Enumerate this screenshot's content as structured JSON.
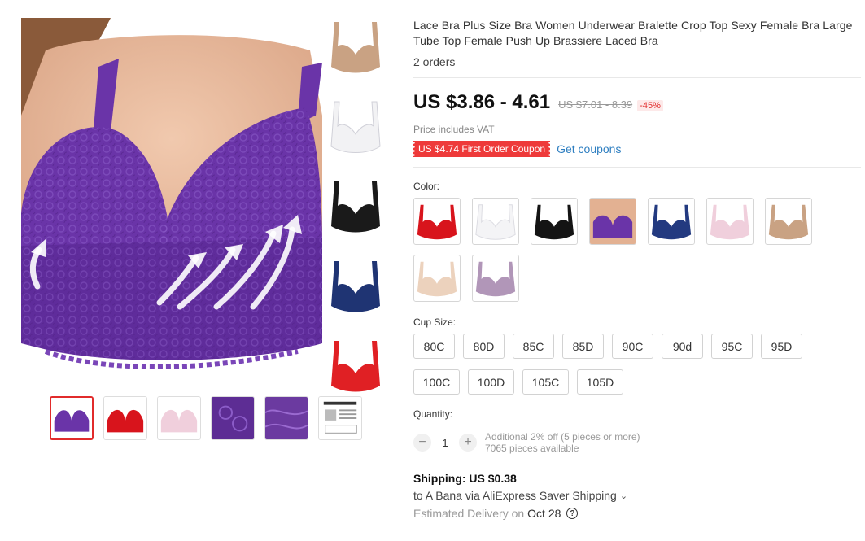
{
  "product": {
    "title": "Lace Bra Plus Size Bra Women Underwear Bralette Crop Top Sexy Female Bra Large Tube Top Female Push Up Brassiere Laced Bra",
    "orders": "2 orders"
  },
  "price": {
    "current": "US $3.86 - 4.61",
    "original": "US $7.01 - 8.39",
    "discount": "-45%",
    "vat_note": "Price includes VAT",
    "coupon": "US $4.74 First Order Coupon",
    "get_coupons": "Get coupons"
  },
  "color": {
    "label": "Color:",
    "options": [
      {
        "name": "red",
        "hex": "#d8141c"
      },
      {
        "name": "white",
        "hex": "#f4f4f6"
      },
      {
        "name": "black",
        "hex": "#141414"
      },
      {
        "name": "purple",
        "hex": "#6a34a8"
      },
      {
        "name": "navy",
        "hex": "#233a80"
      },
      {
        "name": "pink",
        "hex": "#f0cfdc"
      },
      {
        "name": "tan",
        "hex": "#c9a283"
      },
      {
        "name": "beige",
        "hex": "#ecd2bd"
      },
      {
        "name": "lilac",
        "hex": "#b196b8"
      }
    ]
  },
  "cup": {
    "label": "Cup Size:",
    "options": [
      "80C",
      "80D",
      "85C",
      "85D",
      "90C",
      "90d",
      "95C",
      "95D",
      "100C",
      "100D",
      "105C",
      "105D"
    ]
  },
  "quantity": {
    "label": "Quantity:",
    "minus": "−",
    "plus": "+",
    "value": "1",
    "discount_note": "Additional 2% off (5 pieces or more)",
    "available": "7065 pieces available"
  },
  "shipping": {
    "title": "Shipping: US $0.38",
    "route": "to A Bana via AliExpress Saver Shipping",
    "chevron": "⌄",
    "estimated_label": "Estimated Delivery on",
    "date": "Oct 28",
    "help": "?"
  },
  "gallery": {
    "side_colors": [
      "#c9a283",
      "#f2f2f4",
      "#1a1a1a",
      "#1f3473",
      "#e02024"
    ],
    "thumbs": [
      "#6a34a8",
      "#d8141c",
      "#f0cfdc",
      "#5d2d94",
      "#6b3aa0",
      "#ffffff"
    ]
  },
  "colors": {
    "accent_red": "#e12b2b",
    "link_blue": "#2f7fc1",
    "bra_purple": "#6a34a8",
    "skin": "#e8b69a"
  }
}
